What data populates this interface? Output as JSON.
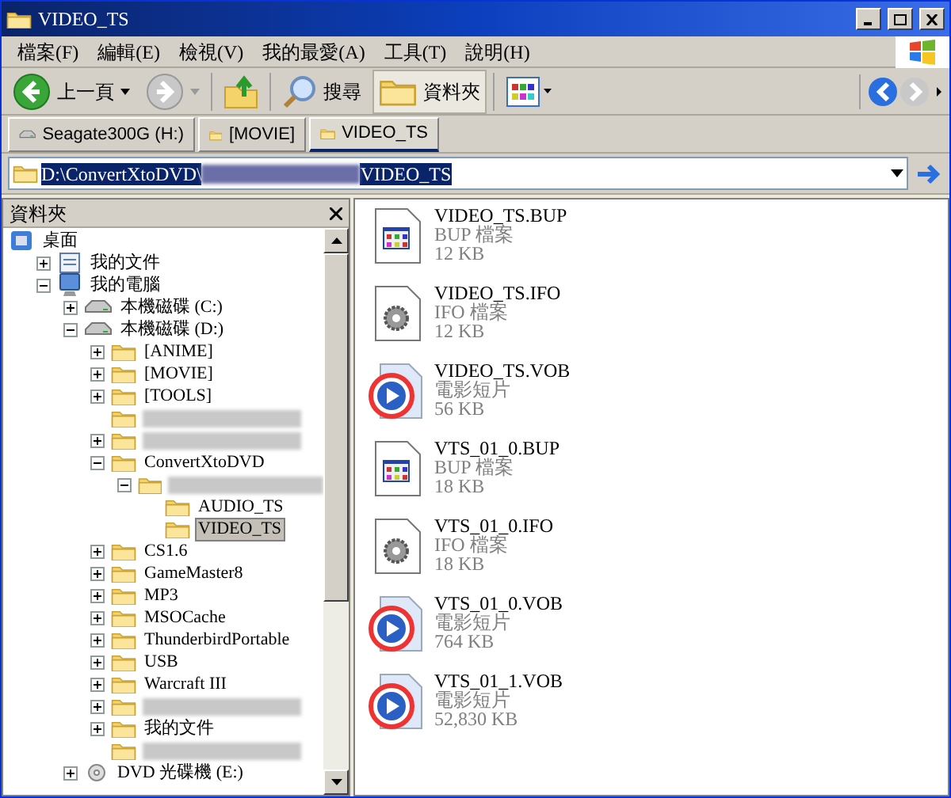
{
  "window": {
    "title": "VIDEO_TS"
  },
  "menu": [
    "檔案(F)",
    "編輯(E)",
    "檢視(V)",
    "我的最愛(A)",
    "工具(T)",
    "說明(H)"
  ],
  "toolbar": [
    {
      "kind": "back",
      "label": "上一頁"
    },
    {
      "kind": "forward"
    },
    {
      "kind": "up"
    },
    {
      "kind": "search",
      "label": "搜尋"
    },
    {
      "kind": "folders",
      "label": "資料夾",
      "selected": true
    },
    {
      "kind": "views"
    }
  ],
  "links": [
    {
      "kind": "drive",
      "label": "Seagate300G (H:)",
      "selected": false
    },
    {
      "kind": "folder",
      "label": "[MOVIE]",
      "selected": false
    },
    {
      "kind": "folder",
      "label": "VIDEO_TS",
      "selected": true
    }
  ],
  "address": {
    "parts": [
      {
        "kind": "text",
        "text": "D:\\ConvertXtoDVD\\"
      },
      {
        "kind": "redacted"
      },
      {
        "kind": "text",
        "text": "VIDEO_TS"
      }
    ]
  },
  "folders_pane": {
    "title": "資料夾",
    "tree": [
      {
        "kind": "desktop",
        "label": "桌面",
        "selected": false,
        "children": [
          {
            "kind": "documents",
            "label": "我的文件",
            "expanded": false,
            "selected": false
          },
          {
            "kind": "computer",
            "label": "我的電腦",
            "expanded": true,
            "selected": false,
            "children": [
              {
                "kind": "drive",
                "label": "本機磁碟 (C:)",
                "expanded": false,
                "selected": false
              },
              {
                "kind": "drive",
                "label": "本機磁碟 (D:)",
                "expanded": true,
                "selected": false,
                "children": [
                  {
                    "kind": "folder",
                    "label": "[ANIME]",
                    "expanded": false,
                    "selected": false
                  },
                  {
                    "kind": "folder",
                    "label": "[MOVIE]",
                    "expanded": false,
                    "selected": false
                  },
                  {
                    "kind": "folder",
                    "label": "[TOOLS]",
                    "expanded": false,
                    "selected": false
                  },
                  {
                    "kind": "folder",
                    "redacted": true,
                    "selected": false
                  },
                  {
                    "kind": "folder",
                    "redacted": true,
                    "expanded": false,
                    "selected": false
                  },
                  {
                    "kind": "folder",
                    "label": "ConvertXtoDVD",
                    "expanded": true,
                    "selected": false,
                    "children": [
                      {
                        "kind": "folder",
                        "redacted": true,
                        "expanded": true,
                        "selected": false,
                        "children": [
                          {
                            "kind": "folder",
                            "label": "AUDIO_TS",
                            "selected": false
                          },
                          {
                            "kind": "folder",
                            "label": "VIDEO_TS",
                            "selected": true
                          }
                        ]
                      }
                    ]
                  },
                  {
                    "kind": "folder",
                    "label": "CS1.6",
                    "expanded": false,
                    "selected": false
                  },
                  {
                    "kind": "folder",
                    "label": "GameMaster8",
                    "expanded": false,
                    "selected": false
                  },
                  {
                    "kind": "folder",
                    "label": "MP3",
                    "expanded": false,
                    "selected": false
                  },
                  {
                    "kind": "folder",
                    "label": "MSOCache",
                    "expanded": false,
                    "selected": false
                  },
                  {
                    "kind": "folder",
                    "label": "ThunderbirdPortable",
                    "expanded": false,
                    "selected": false
                  },
                  {
                    "kind": "folder",
                    "label": "USB",
                    "expanded": false,
                    "selected": false
                  },
                  {
                    "kind": "folder",
                    "label": "Warcraft III",
                    "expanded": false,
                    "selected": false
                  },
                  {
                    "kind": "folder",
                    "redacted": true,
                    "expanded": false,
                    "selected": false
                  },
                  {
                    "kind": "folder",
                    "label": "我的文件",
                    "expanded": false,
                    "selected": false
                  },
                  {
                    "kind": "folder",
                    "redacted": true,
                    "selected": false
                  }
                ]
              },
              {
                "kind": "dvd",
                "label": "DVD 光碟機 (E:)",
                "expanded": false,
                "selected": false
              }
            ]
          }
        ]
      }
    ]
  },
  "files": [
    {
      "kind": "bup",
      "name": "VIDEO_TS.BUP",
      "type": "BUP 檔案",
      "size": "12 KB"
    },
    {
      "kind": "ifo",
      "name": "VIDEO_TS.IFO",
      "type": "IFO 檔案",
      "size": "12 KB"
    },
    {
      "kind": "vob",
      "name": "VIDEO_TS.VOB",
      "type": "電影短片",
      "size": "56 KB"
    },
    {
      "kind": "bup",
      "name": "VTS_01_0.BUP",
      "type": "BUP 檔案",
      "size": "18 KB"
    },
    {
      "kind": "ifo",
      "name": "VTS_01_0.IFO",
      "type": "IFO 檔案",
      "size": "18 KB"
    },
    {
      "kind": "vob",
      "name": "VTS_01_0.VOB",
      "type": "電影短片",
      "size": "764 KB"
    },
    {
      "kind": "vob",
      "name": "VTS_01_1.VOB",
      "type": "電影短片",
      "size": "52,830 KB"
    }
  ]
}
